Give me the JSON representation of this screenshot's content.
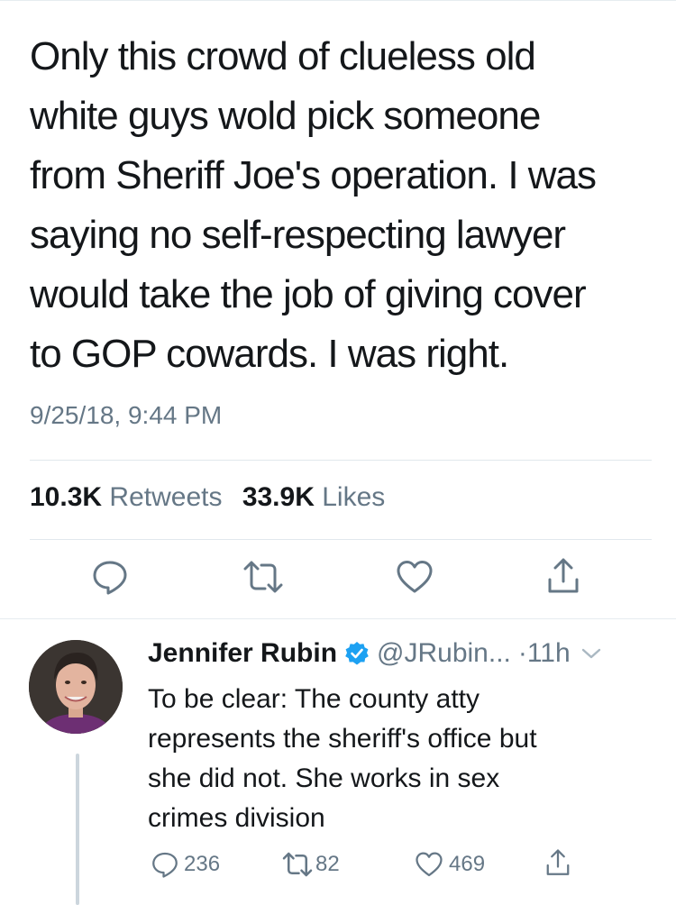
{
  "tweet": {
    "text": "Only this crowd of clueless old\nwhite guys wold pick someone\nfrom Sheriff Joe's operation. I was\nsaying no self-respecting lawyer\nwould take the job of giving cover\nto GOP cowards. I was right.",
    "timestamp": "9/25/18, 9:44 PM",
    "retweet_count": "10.3K",
    "retweet_label": "Retweets",
    "like_count": "33.9K",
    "like_label": "Likes"
  },
  "reply": {
    "name": "Jennifer Rubin",
    "handle": "@JRubin...",
    "time": "·11h",
    "text": "To be clear: The county atty\nrepresents the sheriff's office but\nshe did not. She works in sex\ncrimes division",
    "reply_count": "236",
    "retweet_count": "82",
    "like_count": "469"
  },
  "icons": {
    "reply": "speech-bubble-icon",
    "retweet": "retweet-arrows-icon",
    "like": "heart-icon",
    "share": "share-upload-icon",
    "verified": "verified-badge-icon",
    "menu": "chevron-down-icon"
  },
  "colors": {
    "text": "#14171a",
    "muted": "#657786",
    "verified": "#1da1f2",
    "divider": "#e1e8ed"
  }
}
